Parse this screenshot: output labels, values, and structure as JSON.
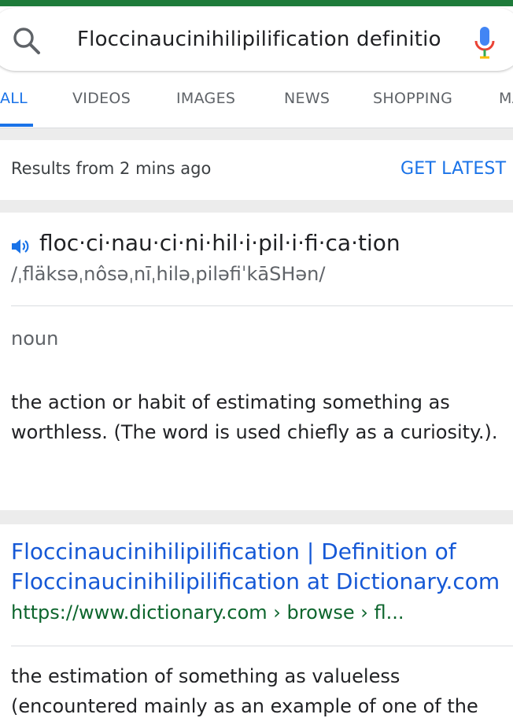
{
  "search": {
    "query": "Floccinaucinihilipilification definitio",
    "icon": "search-icon",
    "mic_icon": "mic-icon"
  },
  "tabs": [
    {
      "label": "ALL",
      "active": true
    },
    {
      "label": "VIDEOS",
      "active": false
    },
    {
      "label": "IMAGES",
      "active": false
    },
    {
      "label": "NEWS",
      "active": false
    },
    {
      "label": "SHOPPING",
      "active": false
    },
    {
      "label": "MA",
      "active": false
    }
  ],
  "results_bar": {
    "time_text": "Results from 2 mins ago",
    "get_latest_label": "GET LATEST"
  },
  "dictionary": {
    "speaker_icon": "speaker-icon",
    "word": "floc·ci·nau·ci·ni·hil·i·pil·i·fi·ca·tion",
    "phonetic": "/ˌfläksəˌnôsəˌnīˌhiləˌpiləfiˈkāSHən/",
    "part_of_speech": "noun",
    "definition": "the action or habit of estimating something as worthless. (The word is used chiefly as a curiosity.)."
  },
  "result": {
    "title": "Floccinaucinihilipilification | Definition of Floccinaucinihilipilification at Dictionary.com",
    "url": "https://www.dictionary.com › browse › fl...",
    "snippet": "the estimation of something as valueless (encountered mainly as an example of one of the"
  },
  "colors": {
    "accent_blue": "#1a73e8",
    "link_blue": "#1558d6",
    "url_green": "#0d652d",
    "top_bar_green": "#1e7b3a"
  }
}
